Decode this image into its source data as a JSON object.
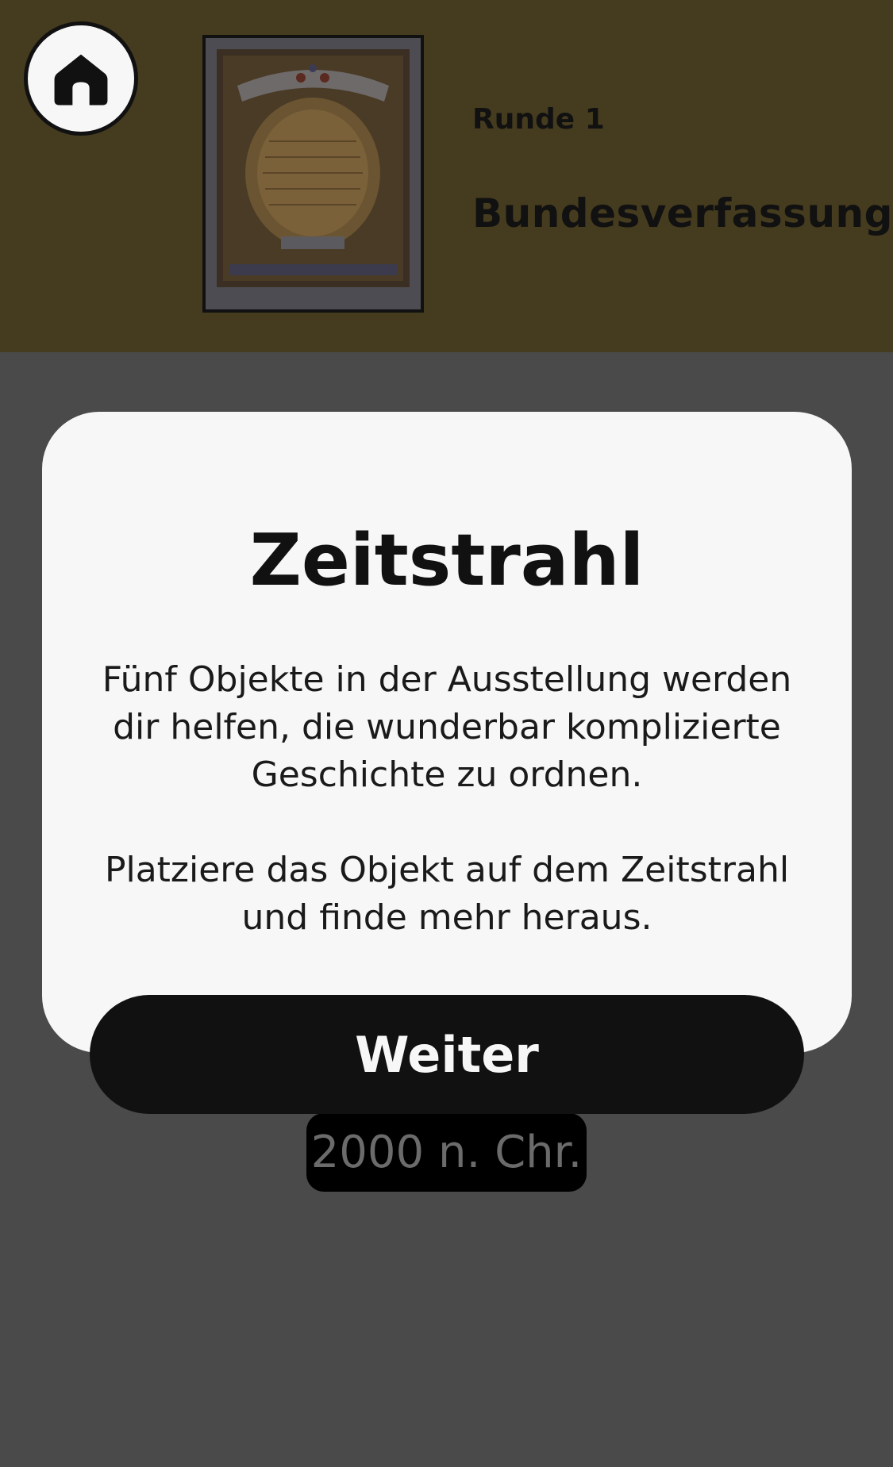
{
  "header": {
    "home_icon": "home-icon",
    "round_label": "Runde 1",
    "object_title": "Bundesverfassung"
  },
  "timeline": {
    "marker_label": "2000 n. Chr."
  },
  "modal": {
    "title": "Zeitstrahl",
    "paragraph1": "Fünf Objekte in der Ausstellung werden dir helfen, die wunderbar komplizierte Geschichte zu ordnen.",
    "paragraph2": "Platziere das Objekt auf dem Zeitstrahl und finde mehr heraus.",
    "continue_label": "Weiter"
  },
  "colors": {
    "header_bg": "#453b1e",
    "overlay_bg": "#4a4a4a",
    "modal_bg": "#f7f7f7",
    "button_bg": "#111111"
  }
}
